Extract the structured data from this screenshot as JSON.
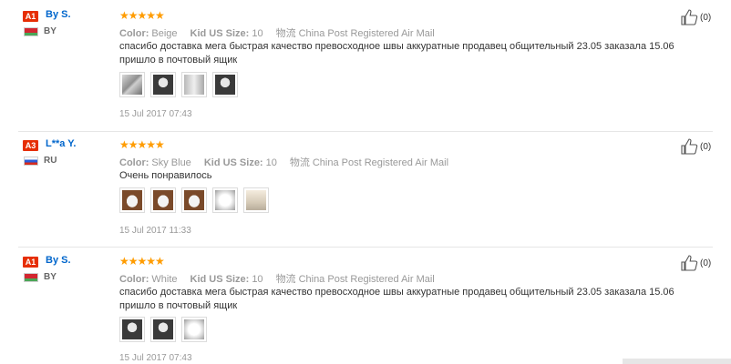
{
  "reviews": [
    {
      "badge": "A1",
      "name": "By S.",
      "country": "BY",
      "flag": "BY",
      "stars": "★★★★★",
      "color_label": "Color:",
      "color_value": "Beige",
      "size_label": "Kid US Size:",
      "size_value": "10",
      "shipping_label": "物流",
      "shipping_value": "China Post Registered Air Mail",
      "text": "спасибо доставка мега быстрая качество превосходное швы аккуратные продавец общительный 23.05 заказала 15.06 пришло в почтовый ящик",
      "photos": [
        "grey",
        "dark",
        "cloth",
        "dark"
      ],
      "date": "15 Jul 2017 07:43",
      "likes": "(0)"
    },
    {
      "badge": "A3",
      "name": "L**a Y.",
      "country": "RU",
      "flag": "RU",
      "stars": "★★★★★",
      "color_label": "Color:",
      "color_value": "Sky Blue",
      "size_label": "Kid US Size:",
      "size_value": "10",
      "shipping_label": "物流",
      "shipping_value": "China Post Registered Air Mail",
      "text": "Очень понравилось",
      "photos": [
        "brown",
        "brown",
        "brown",
        "white",
        "pale"
      ],
      "date": "15 Jul 2017 11:33",
      "likes": "(0)"
    },
    {
      "badge": "A1",
      "name": "By S.",
      "country": "BY",
      "flag": "BY",
      "stars": "★★★★★",
      "color_label": "Color:",
      "color_value": "White",
      "size_label": "Kid US Size:",
      "size_value": "10",
      "shipping_label": "物流",
      "shipping_value": "China Post Registered Air Mail",
      "text": "спасибо доставка мега быстрая качество превосходное швы аккуратные продавец общительный 23.05 заказала 15.06 пришло в почтовый ящик",
      "photos": [
        "dark",
        "dark",
        "white"
      ],
      "date": "15 Jul 2017 07:43",
      "likes": "(0)"
    }
  ],
  "colors": {
    "badge": "#e62e04",
    "name": "#0066cc",
    "stars": "#ff9c00",
    "muted": "#999999"
  }
}
